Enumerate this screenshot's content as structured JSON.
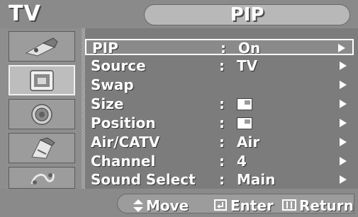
{
  "header": {
    "left_title": "TV",
    "menu_title": "PIP"
  },
  "sidebar": {
    "icons": [
      {
        "name": "picture-icon"
      },
      {
        "name": "input-icon"
      },
      {
        "name": "sound-icon"
      },
      {
        "name": "setup-icon"
      },
      {
        "name": "function-icon"
      }
    ],
    "selected_index": 1
  },
  "menu": {
    "items": [
      {
        "label": "PIP",
        "colon": ":",
        "value": "On",
        "type": "text",
        "selected": true
      },
      {
        "label": "Source",
        "colon": ":",
        "value": "TV",
        "type": "text"
      },
      {
        "label": "Swap",
        "colon": "",
        "value": "",
        "type": "none"
      },
      {
        "label": "Size",
        "colon": ":",
        "value": "",
        "type": "swatch",
        "icon": "size-icon"
      },
      {
        "label": "Position",
        "colon": ":",
        "value": "",
        "type": "swatch",
        "icon": "position-icon"
      },
      {
        "label": "Air/CATV",
        "colon": ":",
        "value": "Air",
        "type": "text"
      },
      {
        "label": "Channel",
        "colon": ":",
        "value": "4",
        "type": "text"
      },
      {
        "label": "Sound Select",
        "colon": ":",
        "value": "Main",
        "type": "text"
      }
    ]
  },
  "footer": {
    "move_label": "Move",
    "enter_label": "Enter",
    "return_label": "Return",
    "move_icon": "up-down-arrow-icon",
    "enter_icon": "enter-icon",
    "return_icon": "menu-icon"
  },
  "colors": {
    "text": "#ffffff",
    "panel": "#7c7c7c",
    "header": "#8a8a8a",
    "selection_border": "#ffffff"
  }
}
